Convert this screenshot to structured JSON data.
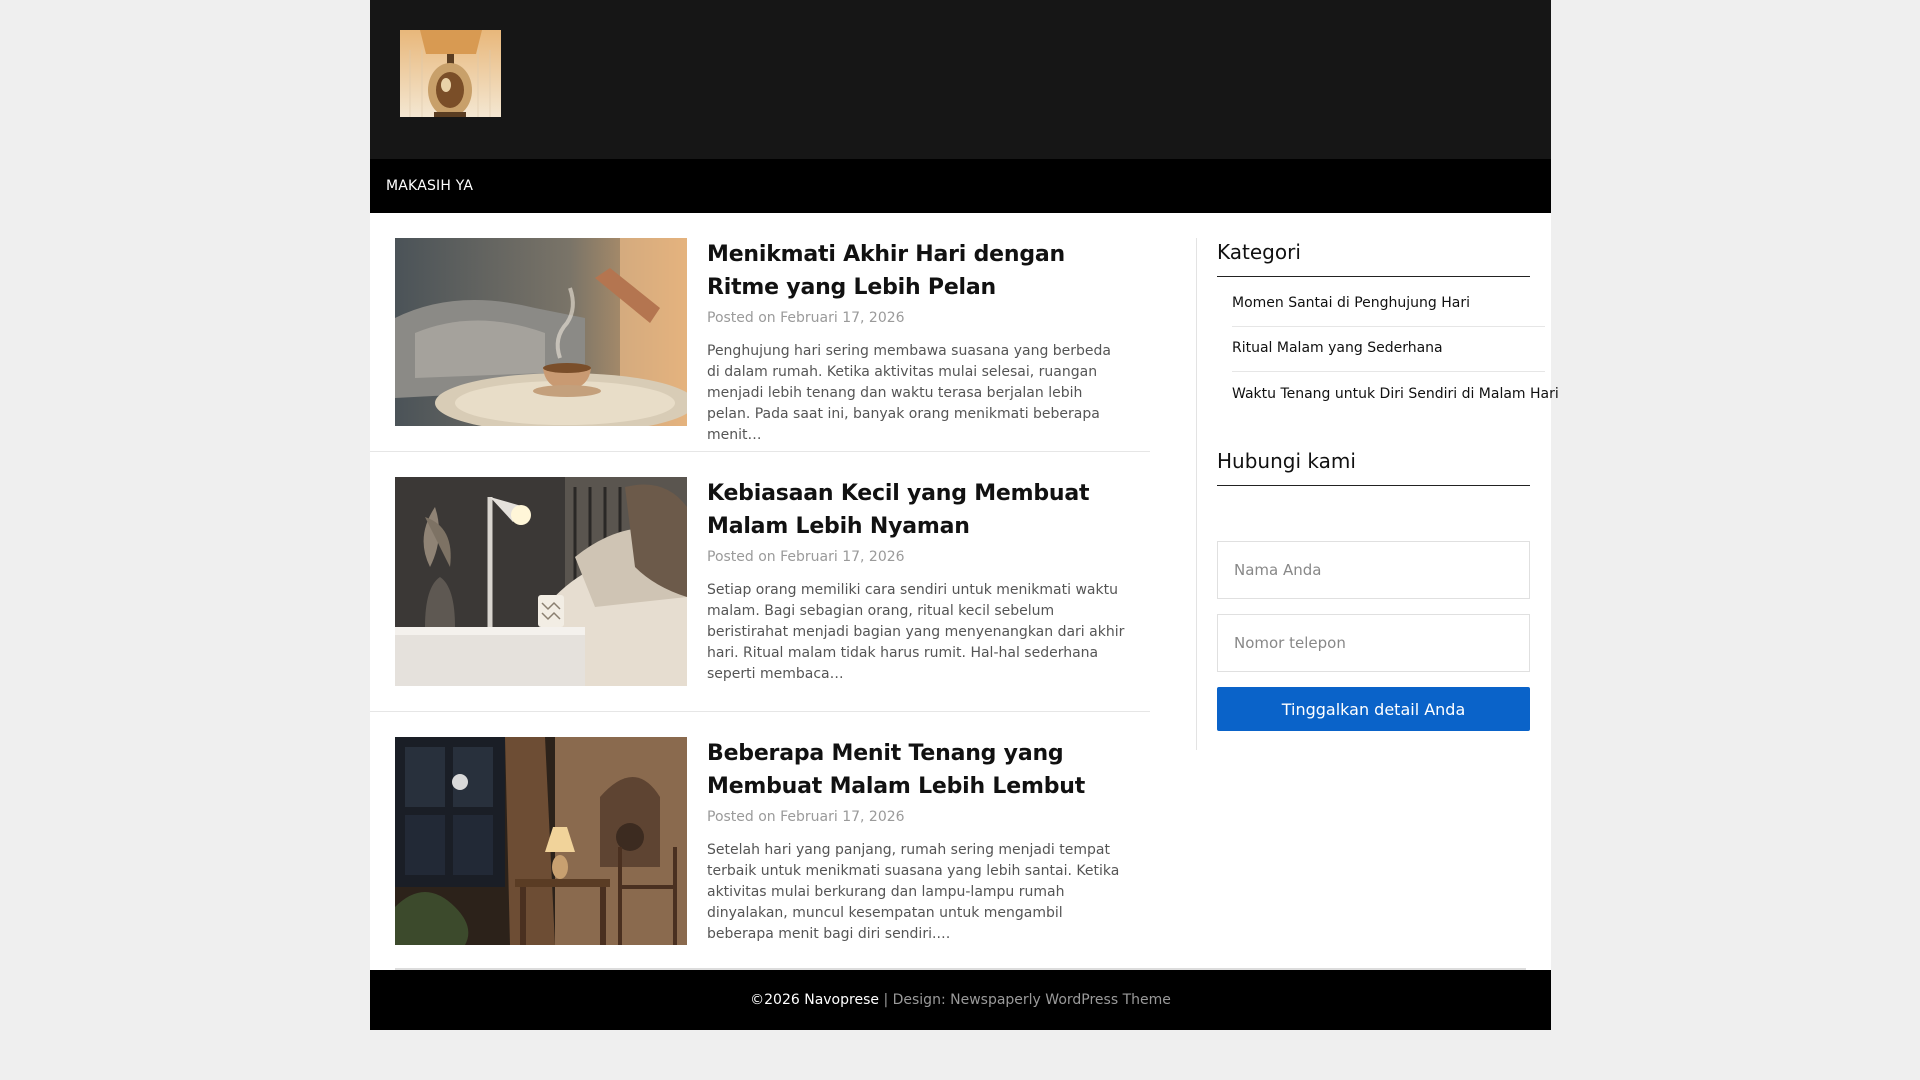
{
  "header": {
    "logo_icon": "lamp-logo-icon"
  },
  "nav": {
    "items": [
      {
        "label": "MAKASIH YA"
      }
    ]
  },
  "posts": [
    {
      "title": "Menikmati Akhir Hari dengan Ritme yang Lebih Pelan",
      "meta": "Posted on Februari 17, 2026",
      "excerpt": "Penghujung hari sering membawa suasana yang berbeda di dalam rumah. Ketika aktivitas mulai selesai, ruangan menjadi lebih tenang dan waktu terasa berjalan lebih pelan. Pada saat ini, banyak orang menikmati beberapa menit…",
      "image": "tea-cup-on-sofa-image"
    },
    {
      "title": "Kebiasaan Kecil yang Membuat Malam Lebih Nyaman",
      "meta": "Posted on Februari 17, 2026",
      "excerpt": "Setiap orang memiliki cara sendiri untuk menikmati waktu malam. Bagi sebagian orang, ritual kecil sebelum beristirahat menjadi bagian yang menyenangkan dari akhir hari. Ritual malam tidak harus rumit. Hal-hal sederhana seperti membaca…",
      "image": "bedside-lamp-mug-image"
    },
    {
      "title": "Beberapa Menit Tenang yang Membuat Malam Lebih Lembut",
      "meta": "Posted on Februari 17, 2026",
      "excerpt": "Setelah hari yang panjang, rumah sering menjadi tempat terbaik untuk menikmati suasana yang lebih santai. Ketika aktivitas mulai berkurang dan lampu-lampu rumah dinyalakan, muncul kesempatan untuk mengambil beberapa menit bagi diri sendiri.…",
      "image": "evening-room-lamp-image"
    }
  ],
  "sidebar": {
    "categories_title": "Kategori",
    "categories": [
      {
        "label": "Momen Santai di Penghujung Hari"
      },
      {
        "label": "Ritual Malam yang Sederhana"
      },
      {
        "label": "Waktu Tenang untuk Diri Sendiri di Malam Hari"
      }
    ],
    "contact_title": "Hubungi kami",
    "form": {
      "name_placeholder": "Nama Anda",
      "phone_placeholder": "Nomor telepon",
      "submit_label": "Tinggalkan detail Anda"
    }
  },
  "footer": {
    "copyright": "©2026 Navoprese",
    "separator": "|",
    "credit": "Design: Newspaperly WordPress Theme"
  },
  "colors": {
    "header_bg": "#161616",
    "nav_bg": "#000000",
    "accent_button": "#0a63c9",
    "page_bg": "#efefef"
  }
}
